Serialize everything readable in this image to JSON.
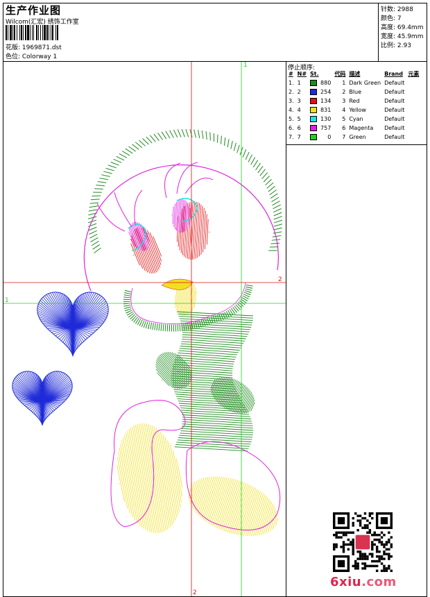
{
  "header": {
    "title": "生产作业图",
    "company": "Wilcom(汇宏) 绣饰工作室",
    "design_label": "花版: 1969871.dst",
    "colorway_label": "色位: Colorway 1"
  },
  "stats": [
    {
      "text": "针数: 2988"
    },
    {
      "text": "颜色: 7"
    },
    {
      "text": "高度: 69.4mm"
    },
    {
      "text": "宽度: 45.9mm"
    },
    {
      "text": "比例: 2.93"
    }
  ],
  "stop_sequence": {
    "title": "停止顺序:",
    "headers": [
      "#",
      "N#",
      "St.",
      "代码",
      "描述",
      "Brand",
      "元素"
    ],
    "rows": [
      {
        "idx": "1.",
        "n": "1",
        "color": "#1e8a1e",
        "st": "880",
        "code": "1",
        "desc": "Dark Green",
        "brand": "Default"
      },
      {
        "idx": "2.",
        "n": "2",
        "color": "#1f2bd8",
        "st": "254",
        "code": "2",
        "desc": "Blue",
        "brand": "Default"
      },
      {
        "idx": "3.",
        "n": "3",
        "color": "#e01010",
        "st": "134",
        "code": "3",
        "desc": "Red",
        "brand": "Default"
      },
      {
        "idx": "4.",
        "n": "4",
        "color": "#f0e020",
        "st": "831",
        "code": "4",
        "desc": "Yellow",
        "brand": "Default"
      },
      {
        "idx": "5.",
        "n": "5",
        "color": "#20e0e8",
        "st": "130",
        "code": "5",
        "desc": "Cyan",
        "brand": "Default"
      },
      {
        "idx": "6.",
        "n": "6",
        "color": "#e020e0",
        "st": "757",
        "code": "6",
        "desc": "Magenta",
        "brand": "Default"
      },
      {
        "idx": "7.",
        "n": "7",
        "color": "#20d020",
        "st": "0",
        "code": "7",
        "desc": "Green",
        "brand": "Default"
      }
    ]
  },
  "guides": {
    "label_top_green": "1",
    "label_right_red": "2",
    "label_left_green": "1",
    "label_bottom_red": "2",
    "green_color": "#20d020",
    "red_color": "#e01010"
  },
  "watermark": {
    "site_main": "6xiu",
    "site_tld": ".com"
  }
}
